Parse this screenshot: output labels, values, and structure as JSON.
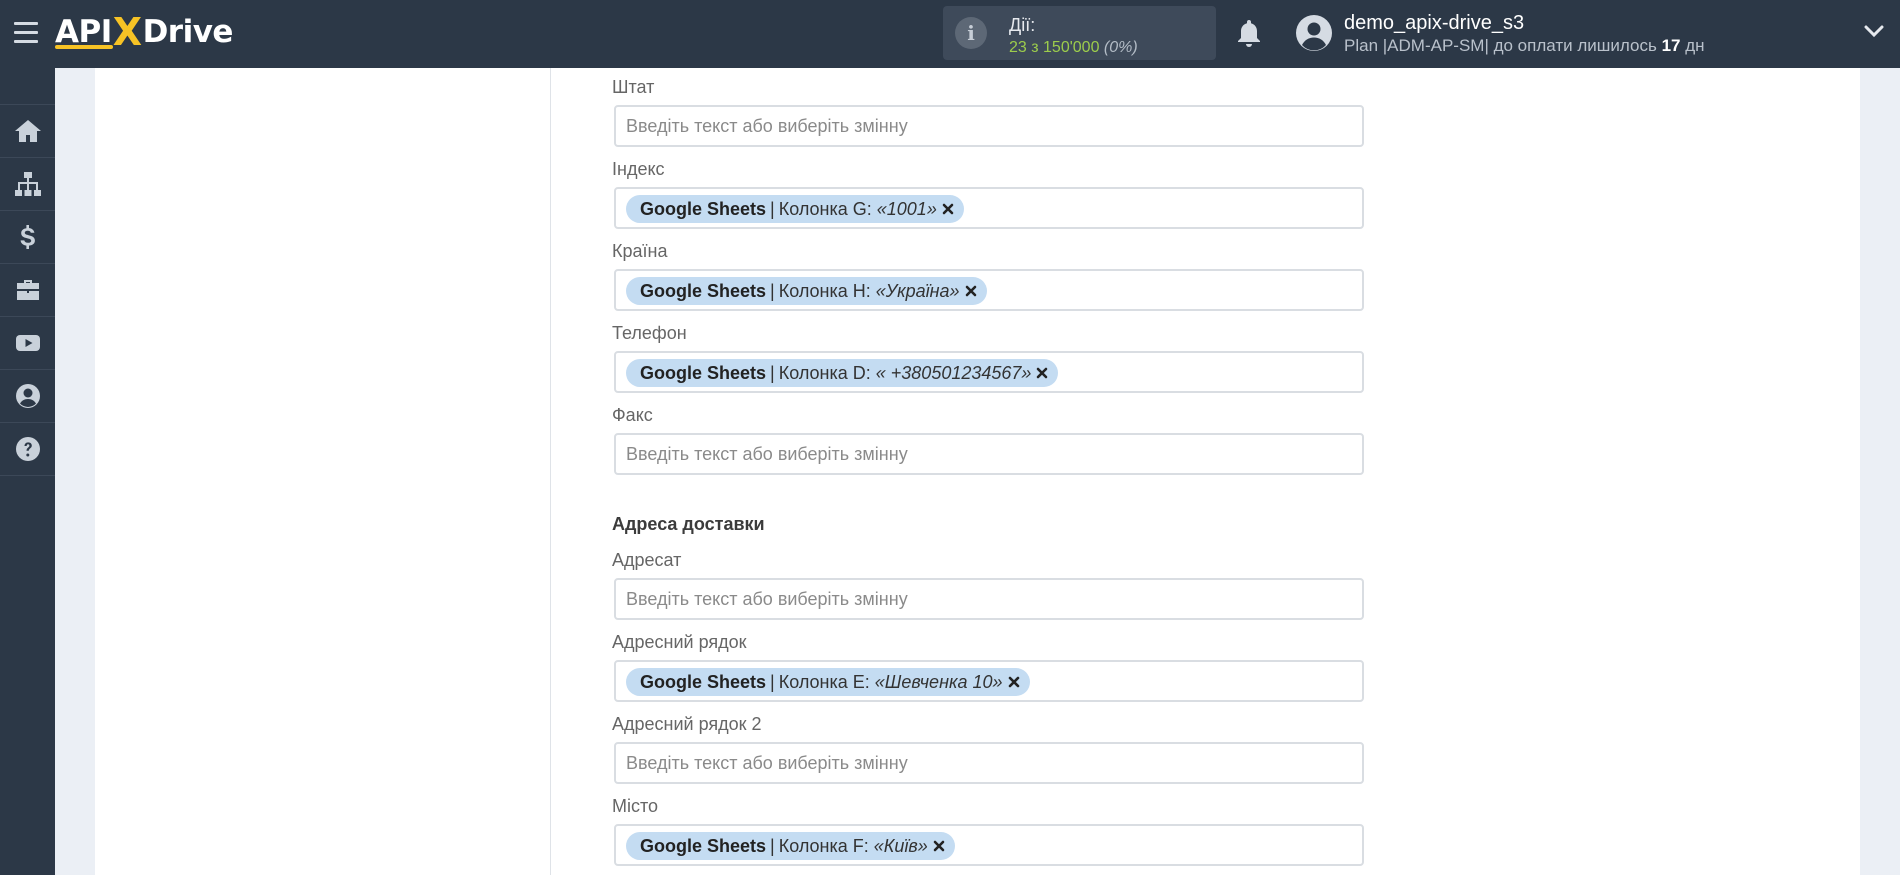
{
  "header": {
    "brand": {
      "part1": "API",
      "part2": "X",
      "part3": "Drive"
    },
    "actions": {
      "label": "Дії:",
      "count": "23 з 150'000",
      "percent": "(0%)"
    },
    "user": {
      "name": "demo_apix-drive_s3",
      "plan_prefix": "Plan |ADM-AP-SM| до оплати лишилось",
      "days": "17",
      "days_suffix": "дн"
    }
  },
  "sidebar": {
    "items": [
      {
        "icon": "home-icon"
      },
      {
        "icon": "sitemap-icon"
      },
      {
        "icon": "dollar-icon"
      },
      {
        "icon": "briefcase-icon"
      },
      {
        "icon": "youtube-icon"
      },
      {
        "icon": "user-circle-icon"
      },
      {
        "icon": "question-circle-icon"
      }
    ]
  },
  "form": {
    "placeholder": "Введіть текст або виберіть змінну",
    "section_delivery": "Адреса доставки",
    "fields": [
      {
        "label": "Штат"
      },
      {
        "label": "Індекс",
        "tag": {
          "source": "Google Sheets",
          "column": "Колонка G:",
          "value": "«1001»"
        }
      },
      {
        "label": "Країна",
        "tag": {
          "source": "Google Sheets",
          "column": "Колонка H:",
          "value": "«Україна»"
        }
      },
      {
        "label": "Телефон",
        "tag": {
          "source": "Google Sheets",
          "column": "Колонка D:",
          "value": "« +380501234567»"
        }
      },
      {
        "label": "Факс"
      },
      {
        "label": "Адресат"
      },
      {
        "label": "Адресний рядок",
        "tag": {
          "source": "Google Sheets",
          "column": "Колонка E:",
          "value": "«Шевченка 10»"
        }
      },
      {
        "label": "Адресний рядок 2"
      },
      {
        "label": "Місто",
        "tag": {
          "source": "Google Sheets",
          "column": "Колонка F:",
          "value": "«Київ»"
        }
      }
    ]
  },
  "colors": {
    "header_bg": "#2c3847",
    "accent_yellow": "#f7c325",
    "tag_bg": "#c4dcf2",
    "actions_green": "#9ccc4c"
  }
}
